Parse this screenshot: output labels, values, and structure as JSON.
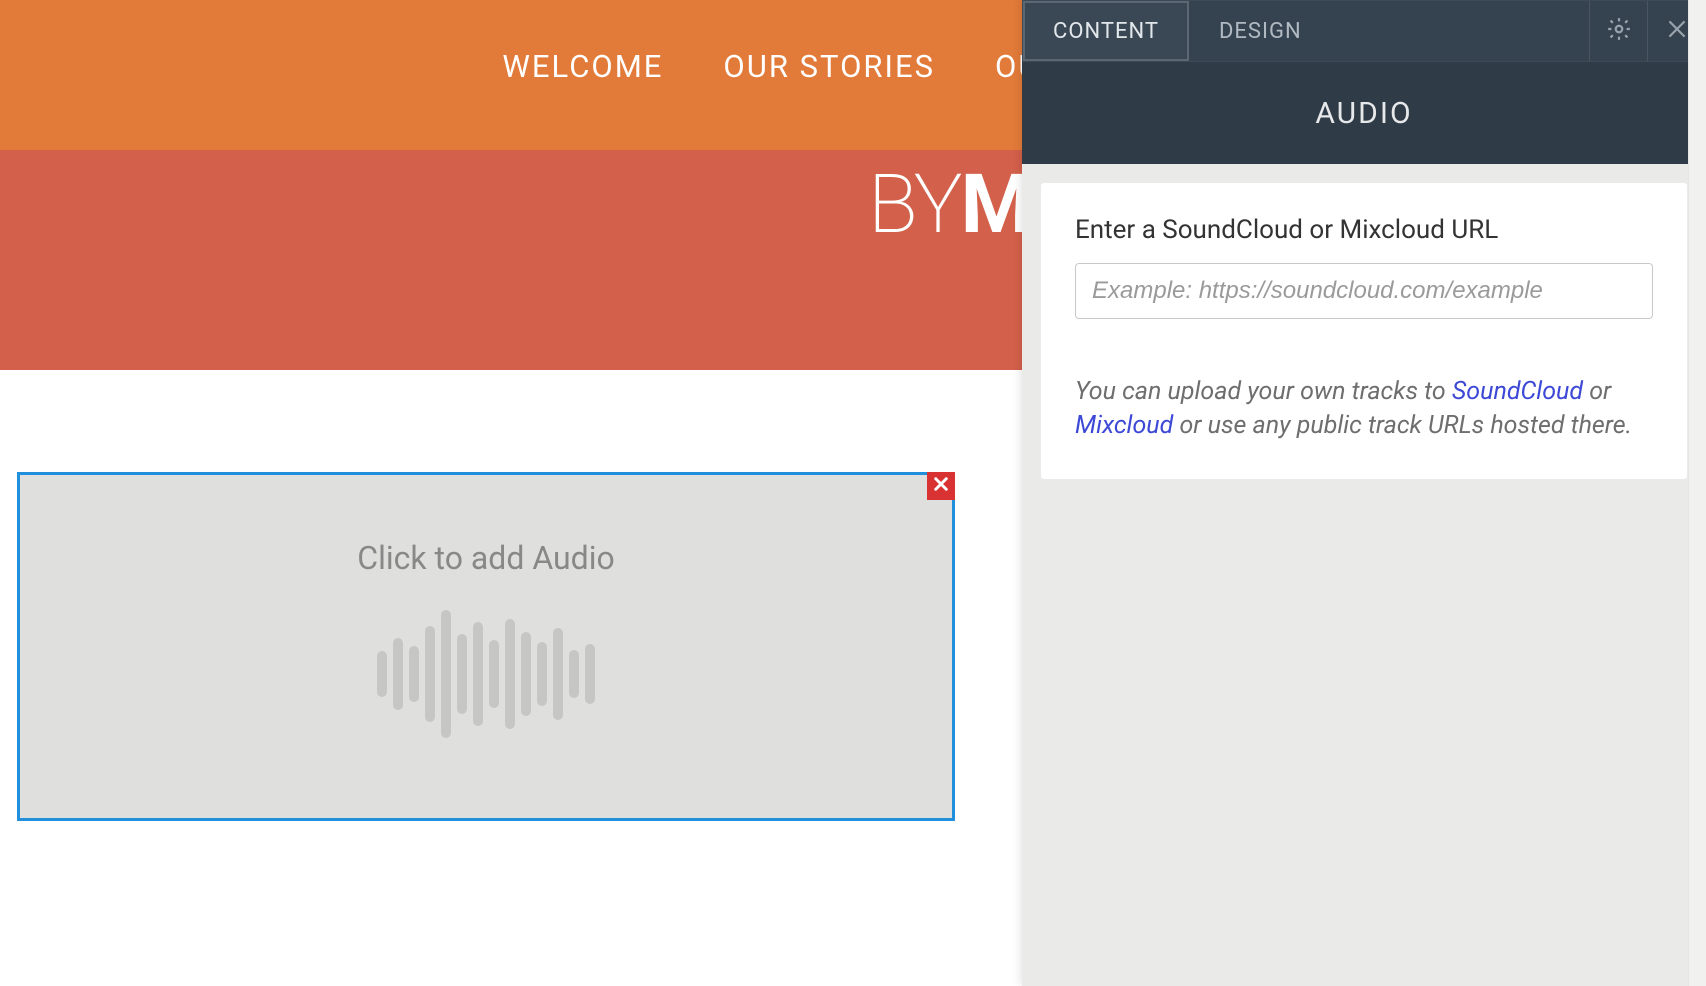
{
  "nav": {
    "items": [
      {
        "label": "WELCOME"
      },
      {
        "label": "OUR STORIES"
      },
      {
        "label": "OUR PHOTOS"
      }
    ]
  },
  "hero": {
    "logo_light": "BY",
    "logo_bold": "M"
  },
  "audio_block": {
    "prompt": "Click to add Audio"
  },
  "panel": {
    "tabs": [
      {
        "label": "CONTENT",
        "active": true
      },
      {
        "label": "DESIGN",
        "active": false
      }
    ],
    "title": "AUDIO",
    "field_label": "Enter a SoundCloud or Mixcloud URL",
    "url_placeholder": "Example: https://soundcloud.com/example",
    "help": {
      "pre": "You can upload your own tracks to ",
      "link1": "SoundCloud",
      "mid": " or ",
      "link2": "Mixcloud",
      "post": " or use any public track URLs hosted there."
    }
  }
}
